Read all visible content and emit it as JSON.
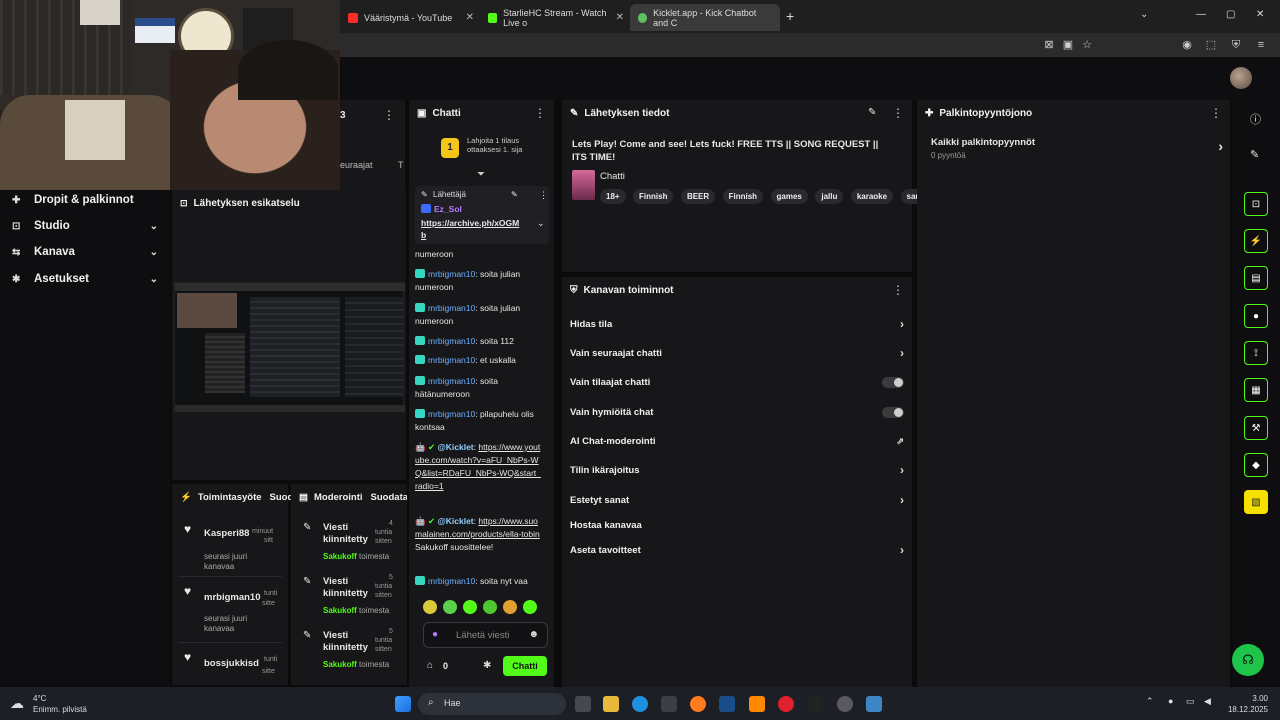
{
  "browser": {
    "tabs": [
      {
        "label": "Vääristymä - YouTube",
        "color": "#ff2b2b"
      },
      {
        "label": "StarlieHC Stream - Watch Live o",
        "color": "#53fc18"
      },
      {
        "label": "Kicklet.app - Kick Chatbot and C",
        "color": "#5fbf5f"
      }
    ],
    "new_tab": "+",
    "window_controls": {
      "min": "—",
      "max": "▢",
      "close": "✕"
    }
  },
  "sidebar": {
    "items": [
      {
        "icon": "gift-icon",
        "label": "Dropit & palkinnot"
      },
      {
        "icon": "studio-icon",
        "label": "Studio"
      },
      {
        "icon": "channel-icon",
        "label": "Kanava"
      },
      {
        "icon": "gear-icon",
        "label": "Asetukset"
      }
    ]
  },
  "partial_panel": {
    "value": "3",
    "label_a": "euraajat",
    "label_b": "T"
  },
  "preview": {
    "title": "Lähetyksen esikatselu"
  },
  "activity": {
    "title": "Toimintasyöte",
    "filter": "Suod",
    "items": [
      {
        "name": "Kasperi88",
        "text": "seurasi juuri kanavaa",
        "time_a": "minuut",
        "time_b": "sitt"
      },
      {
        "name": "mrbigman10",
        "text": "seurasi juuri kanavaa",
        "time_a": "tunti",
        "time_b": "sitte"
      },
      {
        "name": "bossjukkisd",
        "text": "",
        "time_a": "tunti",
        "time_b": "sitte"
      }
    ]
  },
  "moderation": {
    "title": "Moderointi",
    "filter": "Suodata",
    "items": [
      {
        "label": "Viesti kiinnitetty",
        "by": "Sakukoff",
        "suffix": "toimesta",
        "num": "4",
        "t1": "tuntia",
        "t2": "sitten"
      },
      {
        "label": "Viesti kiinnitetty",
        "by": "Sakukoff",
        "suffix": "toimesta",
        "num": "5",
        "t1": "tuntia",
        "t2": "sitten"
      },
      {
        "label": "Viesti kiinnitetty",
        "by": "Sakukoff",
        "suffix": "toimesta",
        "num": "5",
        "t1": "tuntia",
        "t2": "sitten"
      }
    ]
  },
  "chat": {
    "title": "Chatti",
    "gift_rank": "1",
    "gift_text": "Lahjoita 1 tilaus ottaaksesi 1. sija",
    "pinned_label": "Lähettäjä",
    "pinned_user": "Ez_Sol",
    "pinned_link": "https://archive.ph/xOGMb",
    "cont_text": "numeroon",
    "messages": [
      {
        "user": "mrbigman10",
        "text": "soita julian numeroon"
      },
      {
        "user": "mrbigman10",
        "text": "soita julian numeroon"
      },
      {
        "user": "mrbigman10",
        "text": "soita 112"
      },
      {
        "user": "mrbigman10",
        "text": "et uskalla"
      },
      {
        "user": "mrbigman10",
        "text": "soita hätänumeroon"
      },
      {
        "user": "mrbigman10",
        "text": "pilapuhelu olis kontsaa"
      }
    ],
    "bot1_user": "@Kicklet",
    "bot1_link": "https://www.youtube.com/watch?v=aFU_NbPs-WQ&list=RDaFU_NbPs-WQ&start_radio=1",
    "bot2_user": "@Kicklet",
    "bot2_link": "https://www.suomalainen.com/products/ella-tobin",
    "bot2_text": "Sakukoff suosittelee!",
    "last_user": "mrbigman10",
    "last_text": "soita nyt vaa",
    "input_placeholder": "Lähetä viesti",
    "points": "0",
    "send_label": "Chatti"
  },
  "stream_info": {
    "title": "Lähetyksen tiedot",
    "stream_title": "Lets Play! Come and see! Lets fuck! FREE TTS || SONG REQUEST || ITS TIME!",
    "category": "Chatti",
    "tags": [
      "18+",
      "Finnish",
      "BEER",
      "Finnish",
      "games",
      "jallu",
      "karaoke",
      "sauna"
    ]
  },
  "channel_actions": {
    "title": "Kanavan toiminnot",
    "rows": [
      {
        "label": "Hidas tila",
        "control": "arrow"
      },
      {
        "label": "Vain seuraajat chatti",
        "control": "arrow"
      },
      {
        "label": "Vain tilaajat chatti",
        "control": "toggle"
      },
      {
        "label": "Vain hymiöitä chat",
        "control": "toggle"
      },
      {
        "label": "AI Chat-moderointi",
        "control": "external"
      },
      {
        "label": "Tilin ikärajoitus",
        "control": "arrow"
      },
      {
        "label": "Estetyt sanat",
        "control": "arrow"
      },
      {
        "label": "Hostaa kanavaa",
        "control": "none"
      },
      {
        "label": "Aseta tavoitteet",
        "control": "arrow"
      }
    ]
  },
  "rewards": {
    "title": "Palkintopyyntöjono",
    "all_label": "Kaikki palkintopyynnöt",
    "count": "0 pyyntöä"
  },
  "taskbar": {
    "weather_temp": "4°C",
    "weather_text": "Enimm. pilvistä",
    "search": "Hae",
    "time": "3.00",
    "date": "18.12.2025"
  },
  "colors": {
    "accent": "#53fc18",
    "bg": "#0e0e10",
    "panel": "#17171a"
  }
}
